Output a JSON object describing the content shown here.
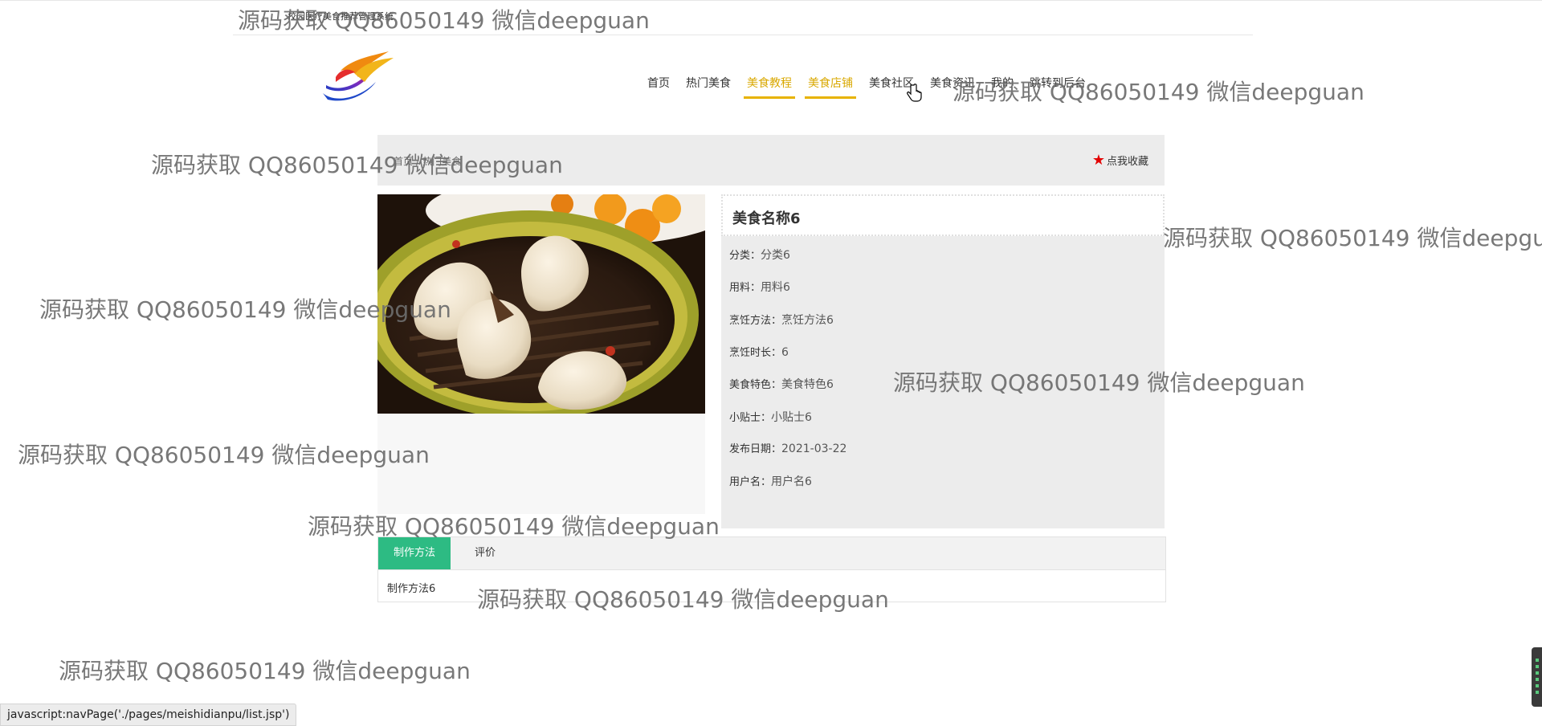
{
  "site": {
    "title": "校园医疗美食推荐管理系统"
  },
  "nav": {
    "items": [
      {
        "label": "首页"
      },
      {
        "label": "热门美食"
      },
      {
        "label": "美食教程"
      },
      {
        "label": "美食店铺"
      },
      {
        "label": "美食社区"
      },
      {
        "label": "美食资讯"
      },
      {
        "label": "我的"
      },
      {
        "label": "跳转到后台"
      }
    ],
    "active_color": "#e7b300"
  },
  "breadcrumb": {
    "home": "首页",
    "separator": "/",
    "current": "热门美食"
  },
  "favorite": {
    "icon": "star-icon",
    "label": "点我收藏",
    "icon_color": "#e30000"
  },
  "detail": {
    "title": "美食名称6",
    "fields": [
      {
        "label": "分类：",
        "value": "分类6"
      },
      {
        "label": "用料：",
        "value": "用料6"
      },
      {
        "label": "烹饪方法：",
        "value": "烹饪方法6"
      },
      {
        "label": "烹饪时长：",
        "value": "6"
      },
      {
        "label": "美食特色：",
        "value": "美食特色6"
      },
      {
        "label": "小贴士：",
        "value": "小贴士6"
      },
      {
        "label": "发布日期：",
        "value": "2021-03-22"
      },
      {
        "label": "用户名：",
        "value": "用户名6"
      }
    ]
  },
  "tabs": {
    "items": [
      {
        "label": "制作方法"
      },
      {
        "label": "评价"
      }
    ],
    "active_color": "#2dbb83",
    "content": "制作方法6"
  },
  "watermark": "源码获取 QQ86050149 微信deepguan",
  "statusbar": {
    "text": "javascript:navPage('./pages/meishidianpu/list.jsp')"
  }
}
